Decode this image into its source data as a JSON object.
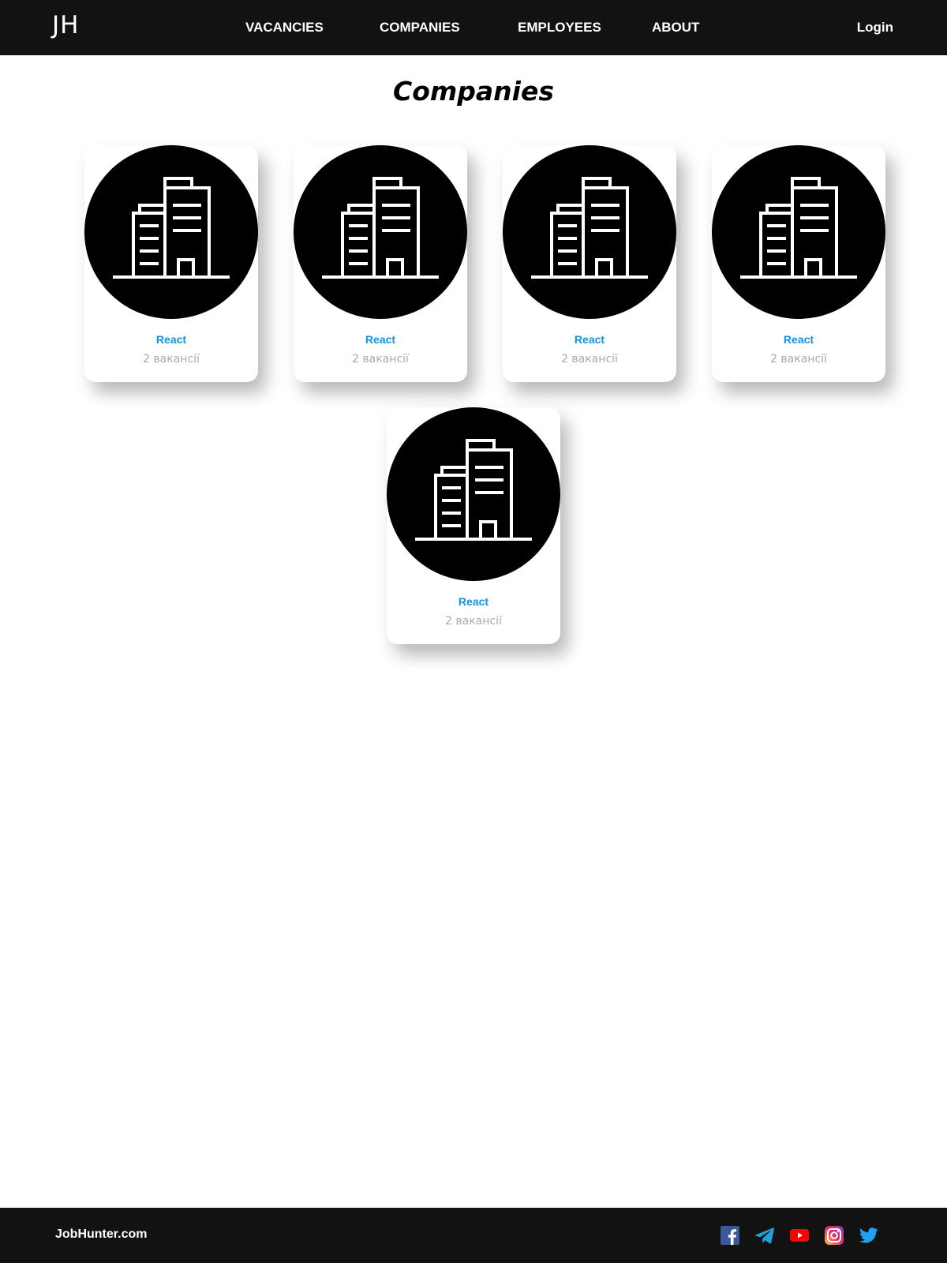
{
  "header": {
    "logo": "JH",
    "nav": [
      {
        "label": "VACANCIES"
      },
      {
        "label": "COMPANIES"
      },
      {
        "label": "EMPLOYEES"
      },
      {
        "label": "ABOUT"
      }
    ],
    "login": "Login"
  },
  "main": {
    "title": "Companies",
    "companies": [
      {
        "name": "React",
        "vacancies": "2 вакансії",
        "icon": "building-icon"
      },
      {
        "name": "React",
        "vacancies": "2 вакансії",
        "icon": "building-icon"
      },
      {
        "name": "React",
        "vacancies": "2 вакансії",
        "icon": "building-icon"
      },
      {
        "name": "React",
        "vacancies": "2 вакансії",
        "icon": "building-icon"
      },
      {
        "name": "React",
        "vacancies": "2 вакансії",
        "icon": "building-icon"
      }
    ]
  },
  "footer": {
    "brand": "JobHunter.com",
    "social": [
      {
        "icon": "facebook-icon",
        "color": "#3b5998"
      },
      {
        "icon": "telegram-icon",
        "color": "#229ed9"
      },
      {
        "icon": "youtube-icon",
        "color": "#ff0000"
      },
      {
        "icon": "instagram-icon",
        "color": "#e1306c"
      },
      {
        "icon": "twitter-icon",
        "color": "#1da1f2"
      }
    ]
  },
  "colors": {
    "header_bg": "#121212",
    "accent": "#1592de",
    "muted": "#a9a9a9"
  }
}
